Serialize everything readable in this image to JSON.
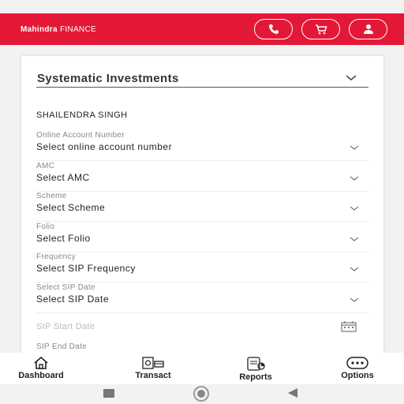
{
  "header": {
    "brand_bold": "Mahindra",
    "brand_rest": " FINANCE",
    "buttons": [
      "phone-icon",
      "cart-icon",
      "profile-icon"
    ],
    "color": "#e31837"
  },
  "form": {
    "title": "Systematic Investments",
    "customer_name": "SHAILENDRA SINGH",
    "fields": [
      {
        "label": "Online Account Number",
        "value": "Select online account number"
      },
      {
        "label": "AMC",
        "value": "Select AMC"
      },
      {
        "label": "Scheme",
        "value": "Select Scheme"
      },
      {
        "label": "Folio",
        "value": "Select Folio"
      },
      {
        "label": "Frequency",
        "value": "Select SIP Frequency"
      },
      {
        "label": "Select SIP Date",
        "value": "Select SIP Date"
      }
    ],
    "sip_start_placeholder": "SIP Start Date",
    "sip_end_label": "SIP End Date"
  },
  "bottom_nav": [
    {
      "label": "Dashboard",
      "icon": "home-icon"
    },
    {
      "label": "Transact",
      "icon": "transact-icon"
    },
    {
      "label": "Reports",
      "icon": "reports-icon"
    },
    {
      "label": "Options",
      "icon": "more-icon"
    }
  ]
}
